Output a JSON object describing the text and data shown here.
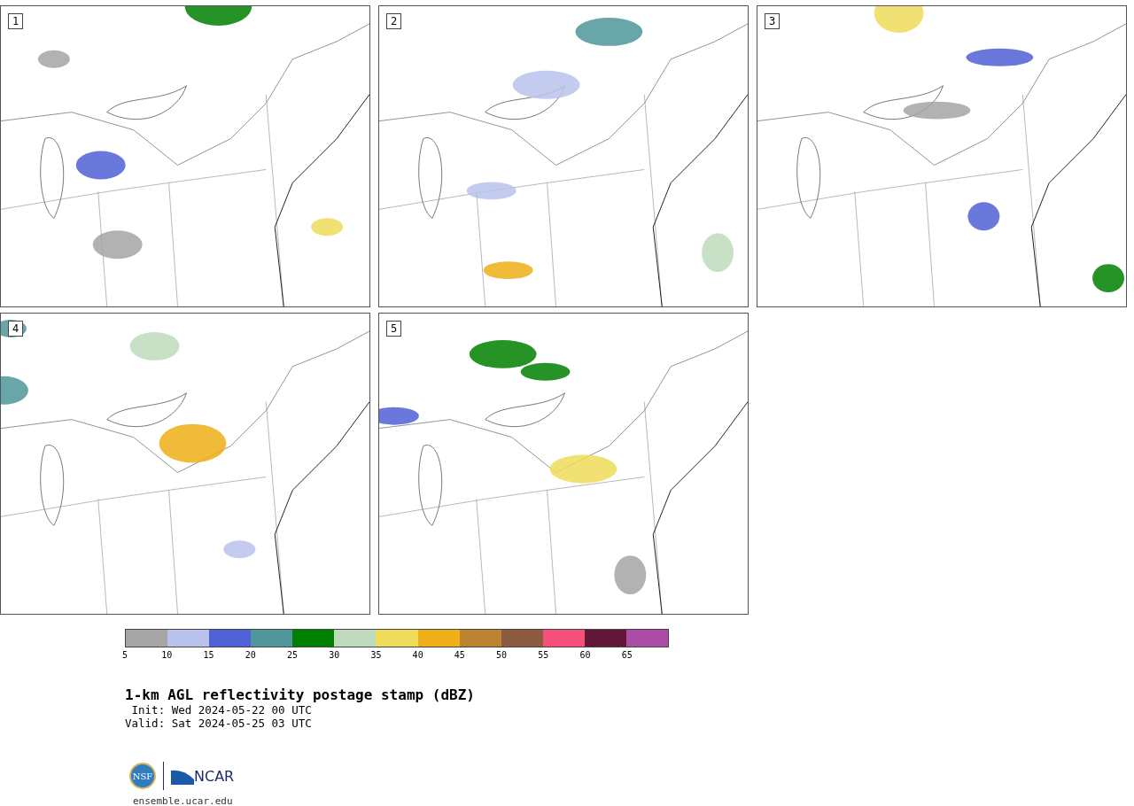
{
  "panels": [
    {
      "label": "1"
    },
    {
      "label": "2"
    },
    {
      "label": "3"
    },
    {
      "label": "4"
    },
    {
      "label": "5"
    }
  ],
  "colorbar": {
    "segments": [
      {
        "color": "#a5a5a5",
        "tick": "5"
      },
      {
        "color": "#b8c2ec",
        "tick": "10"
      },
      {
        "color": "#5060d6",
        "tick": "15"
      },
      {
        "color": "#4f979b",
        "tick": "20"
      },
      {
        "color": "#008000",
        "tick": "25"
      },
      {
        "color": "#bedcbc",
        "tick": "30"
      },
      {
        "color": "#eedc5a",
        "tick": "35"
      },
      {
        "color": "#efaf18",
        "tick": "40"
      },
      {
        "color": "#ba8430",
        "tick": "45"
      },
      {
        "color": "#8b5a3f",
        "tick": "50"
      },
      {
        "color": "#f5507a",
        "tick": "55"
      },
      {
        "color": "#621738",
        "tick": "60"
      },
      {
        "color": "#ad4ca4",
        "tick": "65"
      }
    ]
  },
  "title": "1-km AGL reflectivity postage stamp (dBZ)",
  "init": " Init: Wed 2024-05-22 00 UTC",
  "valid": "Valid: Sat 2024-05-25 03 UTC",
  "logo": {
    "left": "NSF",
    "right": "NCAR"
  },
  "site": "ensemble.ucar.edu"
}
